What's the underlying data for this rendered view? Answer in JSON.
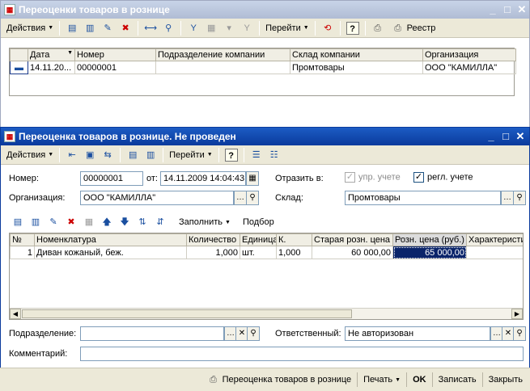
{
  "list_window": {
    "title": "Переоценки товаров в рознице",
    "toolbar": {
      "actions": "Действия",
      "goto": "Перейти",
      "registry": "Реестр",
      "help": "?"
    },
    "columns": [
      "Дата",
      "Номер",
      "Подразделение компании",
      "Склад компании",
      "Организация"
    ],
    "rows": [
      {
        "date": "14.11.20...",
        "number": "00000001",
        "division": "",
        "warehouse": "Промтовары",
        "org": "ООО \"КАМИЛЛА\""
      }
    ]
  },
  "doc_window": {
    "title": "Переоценка товаров в рознице. Не проведен",
    "toolbar": {
      "actions": "Действия",
      "goto": "Перейти",
      "help": "?"
    },
    "number_label": "Номер:",
    "number_value": "00000001",
    "from_label": "от:",
    "date_value": "14.11.2009 14:04:43",
    "reflect_label": "Отразить в:",
    "mgmt_check": "упр. учете",
    "acct_check": "регл. учете",
    "org_label": "Организация:",
    "org_value": "ООО \"КАМИЛЛА\"",
    "warehouse_label": "Склад:",
    "warehouse_value": "Промтовары",
    "tab_toolbar": {
      "fill": "Заполнить",
      "pick": "Подбор"
    },
    "columns": [
      "№",
      "Номенклатура",
      "Количество",
      "Единица",
      "К.",
      "Старая розн. цена",
      "Розн. цена (руб.)",
      "Характеристи"
    ],
    "rows": [
      {
        "n": "1",
        "item": "Диван кожаный, беж.",
        "qty": "1,000",
        "unit": "шт.",
        "k": "1,000",
        "old_price": "60 000,00",
        "new_price": "65 000,00",
        "char": ""
      }
    ],
    "division_label": "Подразделение:",
    "division_value": "",
    "responsible_label": "Ответственный:",
    "responsible_value": "Не авторизован",
    "comment_label": "Комментарий:",
    "comment_value": "",
    "bottom": {
      "print_form": "Переоценка товаров в рознице",
      "print": "Печать",
      "ok": "OK",
      "save": "Записать",
      "close": "Закрыть"
    }
  }
}
